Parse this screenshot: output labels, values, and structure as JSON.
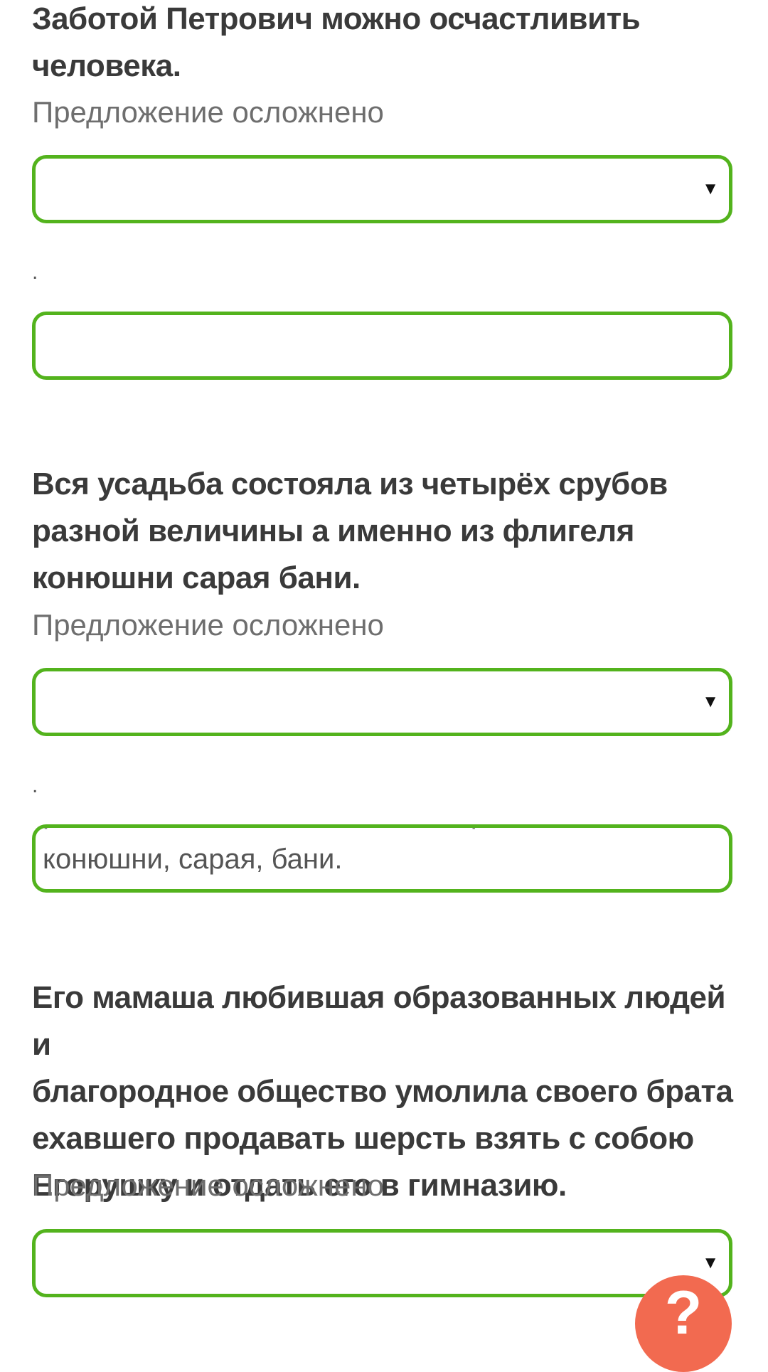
{
  "questions": [
    {
      "sentence_lines": [
        "Заботой Петрович можно осчастливить",
        "человека."
      ],
      "caption": "Предложение осложнено",
      "select_value": "",
      "dot": ".",
      "answer_value": ""
    },
    {
      "sentence_lines": [
        "Вся усадьба состояла из четырёх срубов",
        "разной величины а именно из флигеля",
        "конюшни сарая бани."
      ],
      "caption": "Предложение осложнено",
      "select_value": "",
      "dot": ".",
      "answer_clipped_line": "разной величины, а именно: из флигеля,",
      "answer_value": "конюшни, сарая, бани."
    },
    {
      "sentence_lines": [
        "Его мамаша любившая образованных людей и",
        "благородное общество умолила своего брата",
        "ехавшего продавать шерсть взять с собою",
        "Егорушку и отдать его в гимназию."
      ],
      "caption": "Предложение осложнено",
      "select_value": ""
    }
  ],
  "help_button": {
    "label": "?"
  },
  "icons": {
    "select_arrow": "dropdown-triangle-icon"
  },
  "colors": {
    "field_border": "#53b31d",
    "help_button": "#f26a50"
  }
}
